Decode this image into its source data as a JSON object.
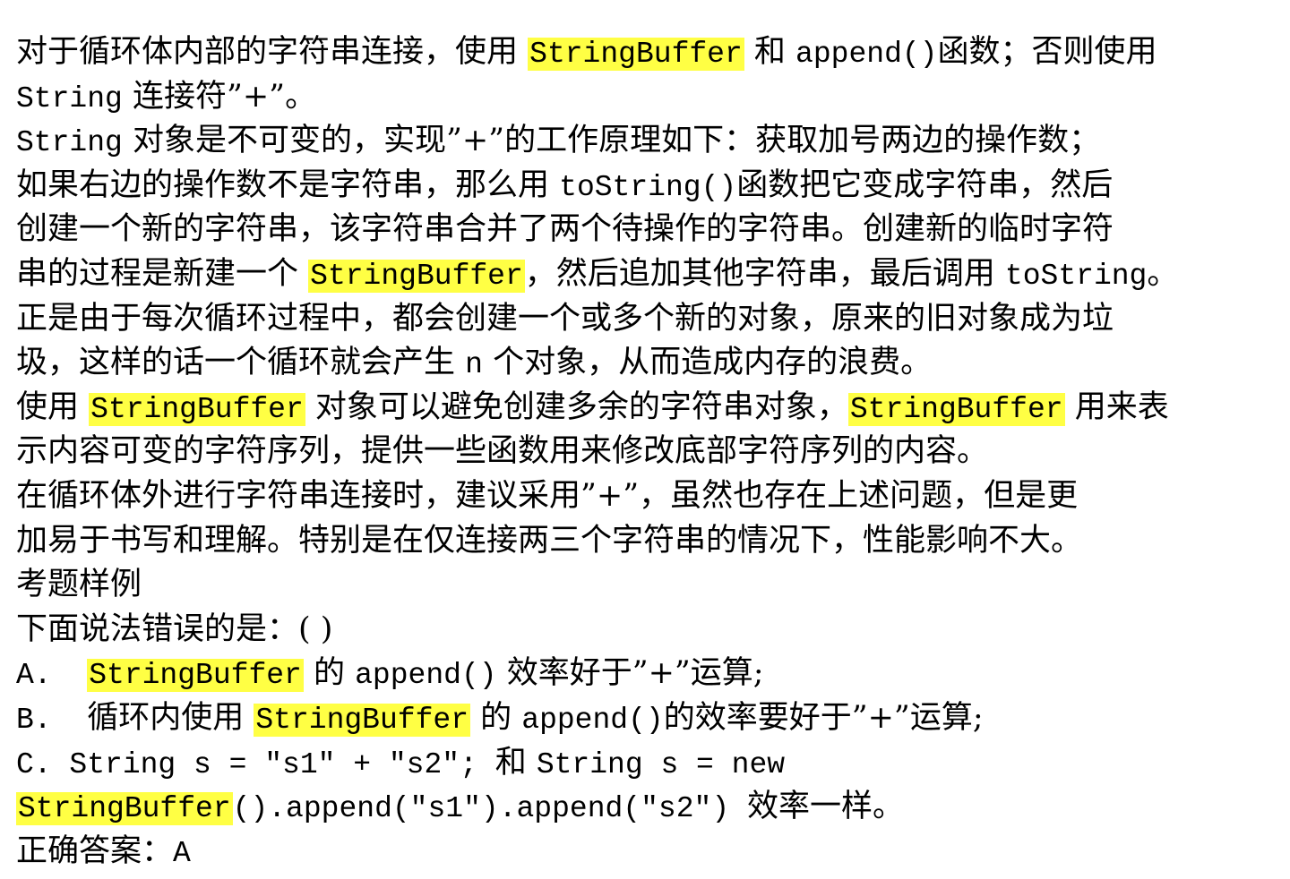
{
  "colors": {
    "highlight": "#ffff44",
    "text": "#000000",
    "background": "#ffffff"
  },
  "lines": [
    [
      {
        "text": "对于循环体内部的字符串连接，使用 "
      },
      {
        "text": "StringBuffer",
        "hl": true
      },
      {
        "text": " 和 "
      },
      {
        "text": "append()",
        "mono": true
      },
      {
        "text": "函数；否则使用"
      }
    ],
    [
      {
        "text": "String",
        "mono": true
      },
      {
        "text": " 连接符”+”。"
      }
    ],
    [
      {
        "text": "String",
        "mono": true
      },
      {
        "text": " 对象是不可变的，实现”+”的工作原理如下：获取加号两边的操作数；"
      }
    ],
    [
      {
        "text": "如果右边的操作数不是字符串，那么用 "
      },
      {
        "text": "toString()",
        "mono": true
      },
      {
        "text": "函数把它变成字符串，然后"
      }
    ],
    [
      {
        "text": "创建一个新的字符串，该字符串合并了两个待操作的字符串。创建新的临时字符"
      }
    ],
    [
      {
        "text": "串的过程是新建一个 "
      },
      {
        "text": "StringBuffer",
        "hl": true
      },
      {
        "text": "，然后追加其他字符串，最后调用 "
      },
      {
        "text": "toString",
        "mono": true
      },
      {
        "text": "。"
      }
    ],
    [
      {
        "text": "正是由于每次循环过程中，都会创建一个或多个新的对象，原来的旧对象成为垃"
      }
    ],
    [
      {
        "text": "圾，这样的话一个循环就会产生 "
      },
      {
        "text": "n",
        "mono": true
      },
      {
        "text": " 个对象，从而造成内存的浪费。"
      }
    ],
    [
      {
        "text": "使用 "
      },
      {
        "text": "StringBuffer",
        "hl": true
      },
      {
        "text": " 对象可以避免创建多余的字符串对象，"
      },
      {
        "text": "StringBuffer",
        "hl": true
      },
      {
        "text": " 用来表"
      }
    ],
    [
      {
        "text": "示内容可变的字符序列，提供一些函数用来修改底部字符序列的内容。"
      }
    ],
    [
      {
        "text": "在循环体外进行字符串连接时，建议采用”+”，虽然也存在上述问题，但是更"
      }
    ],
    [
      {
        "text": "加易于书写和理解。特别是在仅连接两三个字符串的情况下，性能影响不大。"
      }
    ],
    [
      {
        "text": "考题样例"
      }
    ],
    [
      {
        "text": "下面说法错误的是：( )"
      }
    ],
    [
      {
        "text": "A.  ",
        "mono": true
      },
      {
        "text": "StringBuffer",
        "hl": true
      },
      {
        "text": " 的 "
      },
      {
        "text": "append()",
        "mono": true
      },
      {
        "text": " 效率好于”+”运算;"
      }
    ],
    [
      {
        "text": "B.  ",
        "mono": true
      },
      {
        "text": "循环内使用 "
      },
      {
        "text": "StringBuffer",
        "hl": true
      },
      {
        "text": " 的 "
      },
      {
        "text": "append()",
        "mono": true
      },
      {
        "text": "的效率要好于”+”运算;"
      }
    ],
    [
      {
        "text": "C. String s = \"s1\" + \"s2\"; ",
        "mono": true
      },
      {
        "text": "和 "
      },
      {
        "text": "String s = new",
        "mono": true
      }
    ],
    [
      {
        "text": "StringBuffer",
        "hl": true
      },
      {
        "text": "().append(\"s1\").append(\"s2\") ",
        "mono": true
      },
      {
        "text": "效率一样。"
      }
    ],
    [
      {
        "text": "正确答案："
      },
      {
        "text": "A",
        "mono": true
      }
    ]
  ]
}
